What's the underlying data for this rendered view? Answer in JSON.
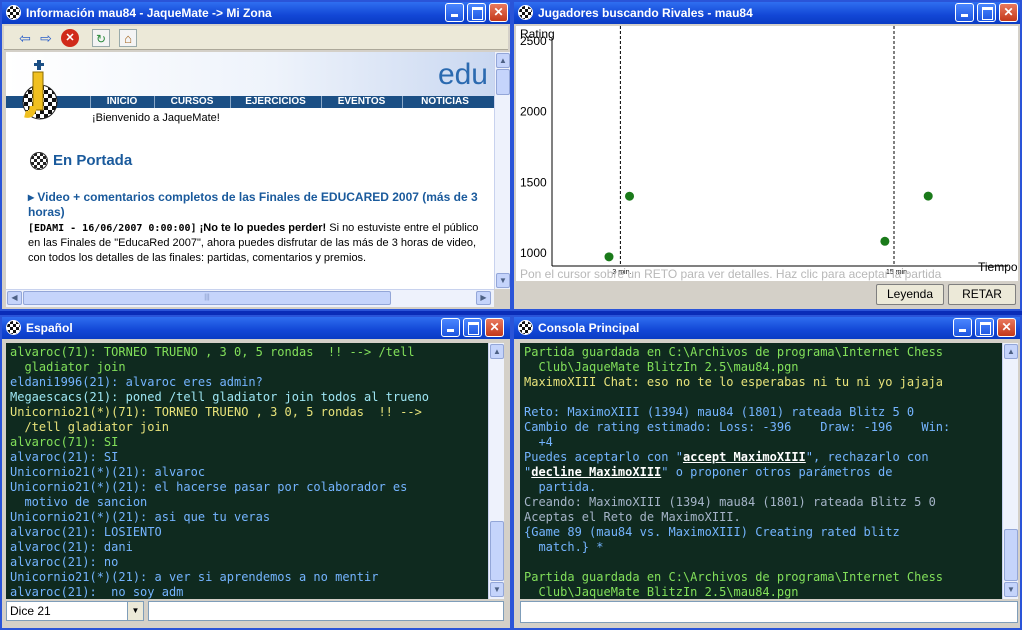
{
  "info_window": {
    "title": "Información mau84 - JaqueMate -> Mi Zona",
    "brand_text": "edu",
    "nav": [
      "INICIO",
      "CURSOS",
      "EJERCICIOS",
      "EVENTOS",
      "NOTICIAS"
    ],
    "welcome": "¡Bienvenido a JaqueMate!",
    "section_title": "En Portada",
    "news_title": "Video + comentarios completos de las Finales de EDUCARED 2007 (más de 3 horas)",
    "news_meta": "[EDAMI - 16/06/2007 0:00:00]",
    "news_lead": "¡No te lo puedes perder!",
    "news_body": " Si no estuviste entre el público en las Finales de \"EducaRed 2007\", ahora puedes disfrutar de las más de 3 horas de video, con todos los detalles de las finales: partidas, comentarios y premios.",
    "toolbar_icons": [
      "back-arrow-icon",
      "forward-arrow-icon",
      "stop-icon",
      "refresh-icon",
      "home-icon"
    ]
  },
  "chart_window": {
    "title": "Jugadores buscando Rivales - mau84",
    "hint": "Pon el cursor sobre un RETO para ver detalles. Haz clic para aceptar la partida",
    "legend_button": "Leyenda",
    "retar_button": "RETAR",
    "point_color": "#1a7a1a"
  },
  "chart_data": {
    "type": "scatter",
    "title": "",
    "ylabel": "Rating",
    "xlabel": "Tiempo",
    "y_ticks": [
      "2500",
      "2000",
      "1500",
      "1000"
    ],
    "x_markers": [
      "3 min.",
      "15 min."
    ],
    "ylim": [
      900,
      2500
    ],
    "grid": false,
    "points": [
      {
        "x": 2.5,
        "y": 965
      },
      {
        "x": 3.4,
        "y": 1394
      },
      {
        "x": 14.6,
        "y": 1075
      },
      {
        "x": 16.5,
        "y": 1395
      }
    ]
  },
  "chat_window": {
    "title": "Español",
    "channel_value": "Dice 21",
    "lines": [
      {
        "c": "c-green",
        "t": "alvaroc(71): TORNEO TRUENO , 3 0, 5 rondas  !! --> /tell"
      },
      {
        "c": "c-green",
        "t": "  gladiator join"
      },
      {
        "c": "c-blue",
        "t": "eldani1996(21): alvaroc eres admin?"
      },
      {
        "c": "c-cyan",
        "t": "Megaescacs(21): poned /tell gladiator join todos al trueno"
      },
      {
        "c": "c-yellow",
        "t": "Unicornio21(*)(71): TORNEO TRUENO , 3 0, 5 rondas  !! -->"
      },
      {
        "c": "c-yellow",
        "t": "  /tell gladiator join"
      },
      {
        "c": "c-green",
        "t": "alvaroc(71): SI"
      },
      {
        "c": "c-blue",
        "t": "alvaroc(21): SI"
      },
      {
        "c": "c-blue",
        "t": "Unicornio21(*)(21): alvaroc"
      },
      {
        "c": "c-blue",
        "t": "Unicornio21(*)(21): el hacerse pasar por colaborador es"
      },
      {
        "c": "c-blue",
        "t": "  motivo de sancion"
      },
      {
        "c": "c-blue",
        "t": "Unicornio21(*)(21): asi que tu veras"
      },
      {
        "c": "c-blue",
        "t": "alvaroc(21): LOSIENTO"
      },
      {
        "c": "c-blue",
        "t": "alvaroc(21): dani"
      },
      {
        "c": "c-blue",
        "t": "alvaroc(21): no"
      },
      {
        "c": "c-blue",
        "t": "Unicornio21(*)(21): a ver si aprendemos a no mentir"
      },
      {
        "c": "c-blue",
        "t": "alvaroc(21):  no soy adm"
      }
    ]
  },
  "console_window": {
    "title": "Consola Principal",
    "lines": [
      {
        "c": "c-green",
        "t": "Partida guardada en C:\\Archivos de programa\\Internet Chess"
      },
      {
        "c": "c-green",
        "t": "  Club\\JaqueMate BlitzIn 2.5\\mau84.pgn"
      },
      {
        "c": "c-yellow",
        "t": "MaximoXIII Chat: eso no te lo esperabas ni tu ni yo jajaja"
      },
      {
        "c": "c-blue",
        "t": ""
      },
      {
        "c": "c-blue",
        "t": "Reto: MaximoXIII (1394) mau84 (1801) rateada Blitz 5 0"
      },
      {
        "c": "c-blue",
        "t": "Cambio de rating estimado: Loss: -396    Draw: -196    Win:"
      },
      {
        "c": "c-blue",
        "t": "  +4"
      },
      {
        "c": "c-blue",
        "t": "Puedes aceptarlo con \"",
        "link": "accept MaximoXIII",
        "after": "\", rechazarlo con"
      },
      {
        "c": "c-blue",
        "t": "\"",
        "link": "decline MaximoXIII",
        "after": "\" o proponer otros parámetros de"
      },
      {
        "c": "c-blue",
        "t": "  partida."
      },
      {
        "c": "c-gray",
        "t": "Creando: MaximoXIII (1394) mau84 (1801) rateada Blitz 5 0"
      },
      {
        "c": "c-gray",
        "t": "Aceptas el Reto de MaximoXIII."
      },
      {
        "c": "c-blue",
        "t": "{Game 89 (mau84 vs. MaximoXIII) Creating rated blitz"
      },
      {
        "c": "c-blue",
        "t": "  match.} *"
      },
      {
        "c": "c-blue",
        "t": ""
      },
      {
        "c": "c-green",
        "t": "Partida guardada en C:\\Archivos de programa\\Internet Chess"
      },
      {
        "c": "c-green",
        "t": "  Club\\JaqueMate BlitzIn 2.5\\mau84.pgn"
      }
    ]
  }
}
